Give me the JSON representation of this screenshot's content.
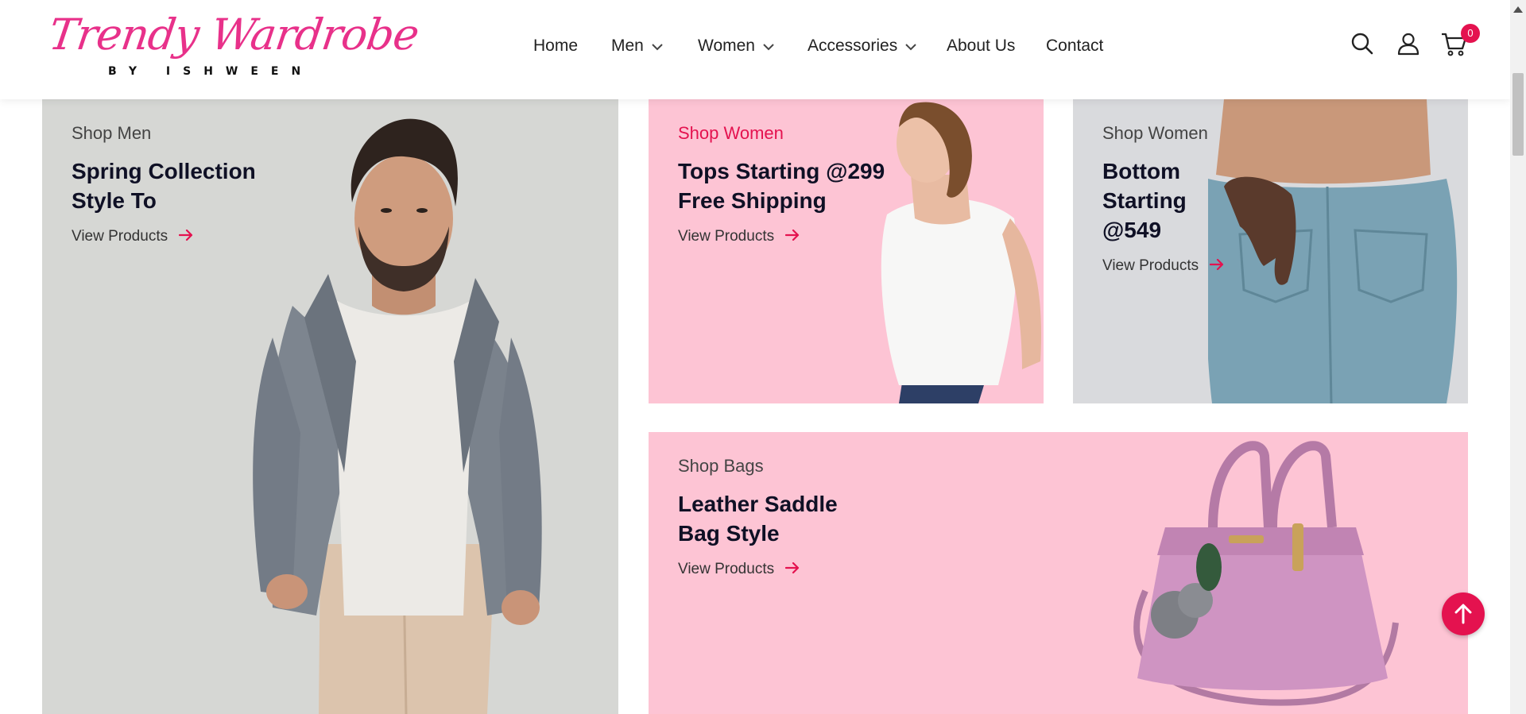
{
  "brand": {
    "script": "Trendy Wardrobe",
    "sub": "BY ISHWEEN",
    "color": "#e8318a"
  },
  "nav": {
    "items": [
      {
        "label": "Home",
        "dropdown": false
      },
      {
        "label": "Men",
        "dropdown": true
      },
      {
        "label": "Women",
        "dropdown": true
      },
      {
        "label": "Accessories",
        "dropdown": true
      },
      {
        "label": "About Us",
        "dropdown": false
      },
      {
        "label": "Contact",
        "dropdown": false
      }
    ]
  },
  "header_icons": {
    "search": "search-icon",
    "account": "user-icon",
    "cart": "cart-icon",
    "cart_count": "0"
  },
  "cards": [
    {
      "kicker": "Shop Men",
      "title_lines": [
        "Spring Collection",
        "Style To"
      ],
      "link": "View Products",
      "bg": "#d6d7d4"
    },
    {
      "kicker": "Shop Women",
      "title_lines": [
        "Tops Starting @299",
        "Free Shipping"
      ],
      "link": "View Products",
      "bg": "#fdc4d4",
      "kicker_accent": true
    },
    {
      "kicker": "Shop Women",
      "title_lines": [
        "Bottom",
        "Starting",
        "@549"
      ],
      "link": "View Products",
      "bg": "#d9dadd"
    },
    {
      "kicker": "Shop Bags",
      "title_lines": [
        "Leather Saddle",
        "Bag Style"
      ],
      "link": "View Products",
      "bg": "#fdc4d4"
    }
  ],
  "colors": {
    "accent": "#e4124f",
    "heading": "#0f1025"
  },
  "back_to_top": "arrow-up-icon"
}
